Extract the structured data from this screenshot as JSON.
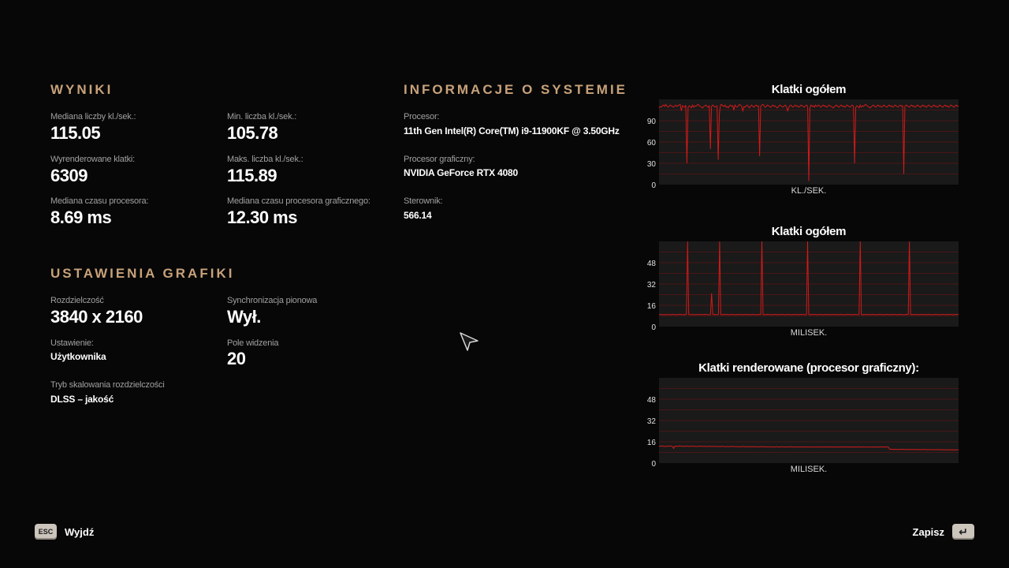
{
  "results": {
    "heading": "WYNIKI",
    "median_fps_label": "Mediana liczby kl./sek.:",
    "median_fps": "115.05",
    "min_fps_label": "Min. liczba kl./sek.:",
    "min_fps": "105.78",
    "rendered_frames_label": "Wyrenderowane klatki:",
    "rendered_frames": "6309",
    "max_fps_label": "Maks. liczba kl./sek.:",
    "max_fps": "115.89",
    "cpu_time_label": "Mediana czasu procesora:",
    "cpu_time": "8.69 ms",
    "gpu_time_label": "Mediana czasu procesora graficznego:",
    "gpu_time": "12.30 ms"
  },
  "graphics": {
    "heading": "USTAWIENIA GRAFIKI",
    "resolution_label": "Rozdzielczość",
    "resolution": "3840 x 2160",
    "vsync_label": "Synchronizacja pionowa",
    "vsync": "Wył.",
    "preset_label": "Ustawienie:",
    "preset": "Użytkownika",
    "fov_label": "Pole widzenia",
    "fov": "20",
    "scaling_label": "Tryb skalowania rozdzielczości",
    "scaling": "DLSS – jakość"
  },
  "system": {
    "heading": "INFORMACJE O SYSTEMIE",
    "cpu_label": "Procesor:",
    "cpu": "11th Gen Intel(R) Core(TM) i9-11900KF @ 3.50GHz",
    "gpu_label": "Procesor graficzny:",
    "gpu": "NVIDIA GeForce RTX 4080",
    "driver_label": "Sterownik:",
    "driver": "566.14"
  },
  "footer": {
    "exit_key": "ESC",
    "exit_label": "Wyjdź",
    "save_label": "Zapisz",
    "save_key": "↵"
  },
  "colors": {
    "accent": "#c8a27a",
    "line": "#d11a1a",
    "grid": "#5a1616",
    "plot_bg": "#1a1a1a"
  },
  "chart_data": [
    {
      "type": "line",
      "title": "Klatki ogółem",
      "xlabel": "KL./SEK.",
      "ylim": [
        0,
        120
      ],
      "yticks": [
        0,
        30,
        60,
        90
      ],
      "grid": true,
      "series": [
        {
          "values": [
            108,
            110,
            109,
            111,
            112,
            110,
            113,
            111,
            109,
            110,
            112,
            111,
            110,
            109,
            111,
            112,
            110,
            111,
            112,
            113,
            104,
            111,
            110,
            109,
            112,
            30,
            109,
            111,
            110,
            108,
            112,
            109,
            111,
            110,
            112,
            113,
            111,
            110,
            109,
            108,
            110,
            111,
            112,
            110,
            109,
            111,
            50,
            110,
            112,
            111,
            109,
            110,
            111,
            35,
            100,
            112,
            113,
            111,
            110,
            112,
            109,
            110,
            108,
            111,
            112,
            110,
            111,
            105,
            112,
            110,
            109,
            111,
            113,
            112,
            110,
            104,
            110,
            109,
            111,
            112,
            110,
            108,
            111,
            112,
            110,
            109,
            111,
            112,
            110,
            111,
            40,
            110,
            112,
            113,
            111,
            109,
            110,
            112,
            111,
            110,
            109,
            111,
            112,
            110,
            111,
            109,
            108,
            110,
            112,
            111,
            110,
            109,
            111,
            112,
            110,
            104,
            108,
            111,
            112,
            110,
            109,
            111,
            112,
            110,
            111,
            109,
            110,
            112,
            111,
            110,
            109,
            111,
            112,
            110,
            5,
            108,
            112,
            110,
            111,
            109,
            112,
            110,
            111,
            112,
            110,
            109,
            111,
            112,
            110,
            111,
            109,
            110,
            112,
            111,
            110,
            109,
            108,
            110,
            111,
            112,
            110,
            109,
            111,
            112,
            110,
            111,
            109,
            110,
            112,
            111,
            110,
            109,
            111,
            112,
            110,
            30,
            109,
            111,
            110,
            108,
            112,
            109,
            111,
            110,
            112,
            113,
            111,
            110,
            109,
            108,
            110,
            111,
            112,
            110,
            109,
            111,
            112,
            110,
            111,
            109,
            110,
            112,
            111,
            110,
            109,
            111,
            112,
            110,
            111,
            109,
            110,
            112,
            111,
            110,
            109,
            111,
            112,
            110,
            111,
            15,
            110,
            112,
            111,
            110,
            109,
            111,
            112,
            110,
            111,
            109,
            110,
            112,
            111,
            110,
            109,
            111,
            112,
            110,
            111,
            109,
            110,
            112,
            111,
            110,
            109,
            111,
            112,
            110,
            111,
            109,
            110,
            112,
            111,
            110,
            109,
            111,
            112,
            110,
            111,
            109,
            110,
            112,
            111,
            110,
            109,
            111,
            112,
            110,
            111
          ]
        }
      ]
    },
    {
      "type": "line",
      "title": "Klatki ogółem",
      "xlabel": "MILISEK.",
      "ylim": [
        0,
        64
      ],
      "yticks": [
        0,
        16,
        32,
        48
      ],
      "grid": true,
      "series": [
        {
          "values": [
            9.1,
            9.0,
            9.2,
            8.9,
            9.0,
            9.1,
            8.8,
            9.0,
            9.2,
            9.1,
            8.9,
            9.0,
            9.1,
            9.2,
            9.0,
            8.9,
            9.1,
            9.0,
            9.2,
            9.1,
            9.0,
            8.9,
            9.1,
            9.0,
            9.2,
            64,
            9.1,
            9.0,
            8.9,
            9.2,
            9.0,
            9.1,
            8.9,
            9.0,
            9.2,
            9.1,
            9.0,
            8.9,
            9.1,
            9.0,
            9.2,
            9.1,
            9.0,
            8.9,
            9.1,
            9.0,
            25,
            9.1,
            9.0,
            9.2,
            8.9,
            9.0,
            9.1,
            64,
            9.0,
            8.9,
            9.1,
            9.0,
            9.2,
            9.1,
            9.0,
            8.9,
            9.1,
            9.0,
            9.2,
            9.1,
            9.0,
            8.9,
            9.1,
            9.0,
            9.2,
            9.1,
            9.0,
            8.9,
            9.1,
            9.0,
            9.2,
            9.1,
            9.0,
            8.9,
            9.1,
            9.0,
            9.2,
            9.1,
            9.0,
            8.9,
            9.1,
            9.0,
            9.2,
            9.1,
            64,
            9.0,
            8.9,
            9.1,
            9.0,
            9.2,
            9.1,
            9.0,
            8.9,
            9.1,
            9.0,
            9.2,
            9.1,
            9.0,
            8.9,
            9.1,
            9.0,
            9.2,
            9.1,
            9.0,
            8.9,
            9.1,
            9.0,
            9.2,
            9.1,
            9.0,
            8.9,
            9.1,
            9.0,
            9.2,
            9.1,
            9.0,
            8.9,
            9.1,
            9.0,
            9.2,
            9.1,
            9.0,
            8.9,
            9.1,
            64,
            9.0,
            8.9,
            9.1,
            9.0,
            9.2,
            9.1,
            9.0,
            8.9,
            9.1,
            9.0,
            9.2,
            9.1,
            9.0,
            8.9,
            9.1,
            9.0,
            9.2,
            9.1,
            9.0,
            8.9,
            9.1,
            9.0,
            9.2,
            9.1,
            9.0,
            8.9,
            9.1,
            9.0,
            9.2,
            9.1,
            9.0,
            8.9,
            9.1,
            9.0,
            9.2,
            9.1,
            9.0,
            8.9,
            9.1,
            9.0,
            9.2,
            9.1,
            9.0,
            8.9,
            9.1,
            64,
            9.0,
            8.9,
            9.1,
            9.0,
            9.2,
            9.1,
            9.0,
            8.9,
            9.1,
            9.0,
            9.2,
            9.1,
            9.0,
            8.9,
            9.1,
            9.0,
            9.2,
            9.1,
            9.0,
            8.9,
            9.1,
            9.0,
            9.2,
            9.1,
            9.0,
            8.9,
            9.1,
            9.0,
            9.2,
            9.1,
            9.0,
            8.9,
            9.1,
            9.0,
            9.2,
            9.1,
            9.0,
            8.9,
            9.1,
            9.0,
            9.2,
            9.1,
            64,
            9.0,
            8.9,
            9.1,
            9.0,
            9.2,
            9.1,
            9.0,
            8.9,
            9.1,
            9.0,
            9.2,
            9.1,
            9.0,
            8.9,
            9.1,
            9.0,
            9.2,
            9.1,
            9.0,
            8.9,
            9.1,
            9.0,
            9.2,
            9.1,
            9.0,
            8.9,
            9.1,
            9.0,
            9.2,
            9.1,
            9.0,
            8.9,
            9.1,
            9.0,
            9.2,
            9.1,
            9.0,
            8.9,
            9.1,
            9.0,
            9.2,
            9.1,
            9.0
          ]
        }
      ]
    },
    {
      "type": "line",
      "title": "Klatki renderowane (procesor graficzny):",
      "xlabel": "MILISEK.",
      "ylim": [
        0,
        64
      ],
      "yticks": [
        0,
        16,
        32,
        48
      ],
      "grid": true,
      "series": [
        {
          "values": [
            12.5,
            12.8,
            12.6,
            12.9,
            12.7,
            12.4,
            12.6,
            12.8,
            12.5,
            12.7,
            12.9,
            12.6,
            12.4,
            11.0,
            12.8,
            12.6,
            12.7,
            12.5,
            12.9,
            12.8,
            12.6,
            12.7,
            12.5,
            12.6,
            12.8,
            12.7,
            12.6,
            12.5,
            12.7,
            12.8,
            12.6,
            12.5,
            12.7,
            12.6,
            12.4,
            12.6,
            12.8,
            12.5,
            12.7,
            12.6,
            12.5,
            12.6,
            12.4,
            12.5,
            12.6,
            12.7,
            12.5,
            12.4,
            12.6,
            12.5,
            12.4,
            12.6,
            12.5,
            12.3,
            12.5,
            12.4,
            12.6,
            12.5,
            12.4,
            12.3,
            12.5,
            12.4,
            12.3,
            12.5,
            12.4,
            12.6,
            12.3,
            12.4,
            12.5,
            12.3,
            12.4,
            12.2,
            12.4,
            12.3,
            12.5,
            12.4,
            12.2,
            12.3,
            12.4,
            12.2,
            12.3,
            12.4,
            12.3,
            12.2,
            12.3,
            12.4,
            12.2,
            12.3,
            12.1,
            12.3,
            12.2,
            12.4,
            12.3,
            12.1,
            12.2,
            12.3,
            12.2,
            12.1,
            12.3,
            12.2,
            12.1,
            12.0,
            12.2,
            12.1,
            12.3,
            12.2,
            12.0,
            12.1,
            12.2,
            12.3,
            12.1,
            12.2,
            12.0,
            12.1,
            12.2,
            12.1,
            12.3,
            12.2,
            12.1,
            12.0,
            12.2,
            12.1,
            12.2,
            12.0,
            12.1,
            12.2,
            12.0,
            12.1,
            12.2,
            12.1,
            12.0,
            12.2,
            12.1,
            12.0,
            12.1,
            12.2,
            12.0,
            12.1,
            12.0,
            12.2,
            12.1,
            12.0,
            12.1,
            12.2,
            12.0,
            12.1,
            12.3,
            12.0,
            12.1,
            12.2,
            12.0,
            12.1,
            12.0,
            12.2,
            12.1,
            12.0,
            12.1,
            12.0,
            12.2,
            12.1,
            12.0,
            12.1,
            12.2,
            12.0,
            12.1,
            12.0,
            12.2,
            12.1,
            12.0,
            12.1,
            12.0,
            12.2,
            12.1,
            12.0,
            12.1,
            12.0,
            12.2,
            12.1,
            12.0,
            12.1,
            12.0,
            12.2,
            12.1,
            12.0,
            12.1,
            12.0,
            12.2,
            12.1,
            12.0,
            12.1,
            12.0,
            12.2,
            12.1,
            12.0,
            12.1,
            12.0,
            12.2,
            12.1,
            12.0,
            12.1,
            12.0,
            12.2,
            12.1,
            12.0,
            10.5,
            10.3,
            10.4,
            10.2,
            10.3,
            10.4,
            10.2,
            10.3,
            10.1,
            10.3,
            10.2,
            10.4,
            10.3,
            10.2,
            10.1,
            10.3,
            10.2,
            10.3,
            10.1,
            10.2,
            10.3,
            10.2,
            10.1,
            10.2,
            10.3,
            10.1,
            10.2,
            10.0,
            10.2,
            10.1,
            10.3,
            10.2,
            10.1,
            10.0,
            10.2,
            10.1,
            10.0,
            10.1,
            10.2,
            10.0,
            10.1,
            10.0,
            10.2,
            10.1,
            10.0,
            10.1,
            10.0,
            9.9,
            10.1,
            10.0,
            9.9,
            10.0,
            10.1,
            9.9,
            10.0,
            9.9,
            10.0,
            9.8,
            9.9,
            10.0,
            9.9,
            9.8
          ]
        }
      ]
    }
  ]
}
